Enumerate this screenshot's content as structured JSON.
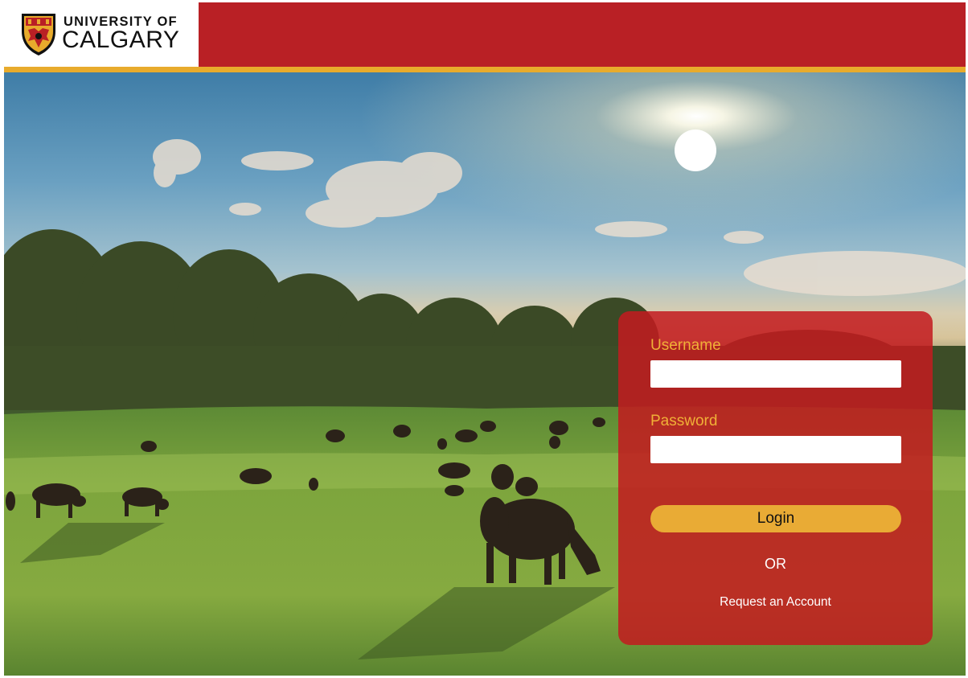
{
  "header": {
    "logo_line1": "UNIVERSITY OF",
    "logo_line2": "CALGARY",
    "bar_color": "#b92025",
    "accent_color": "#e8ab2c"
  },
  "hero": {
    "image": "pasture-with-grazing-cattle-at-sunrise"
  },
  "login": {
    "username_label": "Username",
    "username_value": "",
    "password_label": "Password",
    "password_value": "",
    "login_button": "Login",
    "separator": "OR",
    "request_account_link": "Request an Account",
    "panel_color": "#c31b1f",
    "label_color": "#f0b037",
    "button_color": "#e9ab35"
  }
}
